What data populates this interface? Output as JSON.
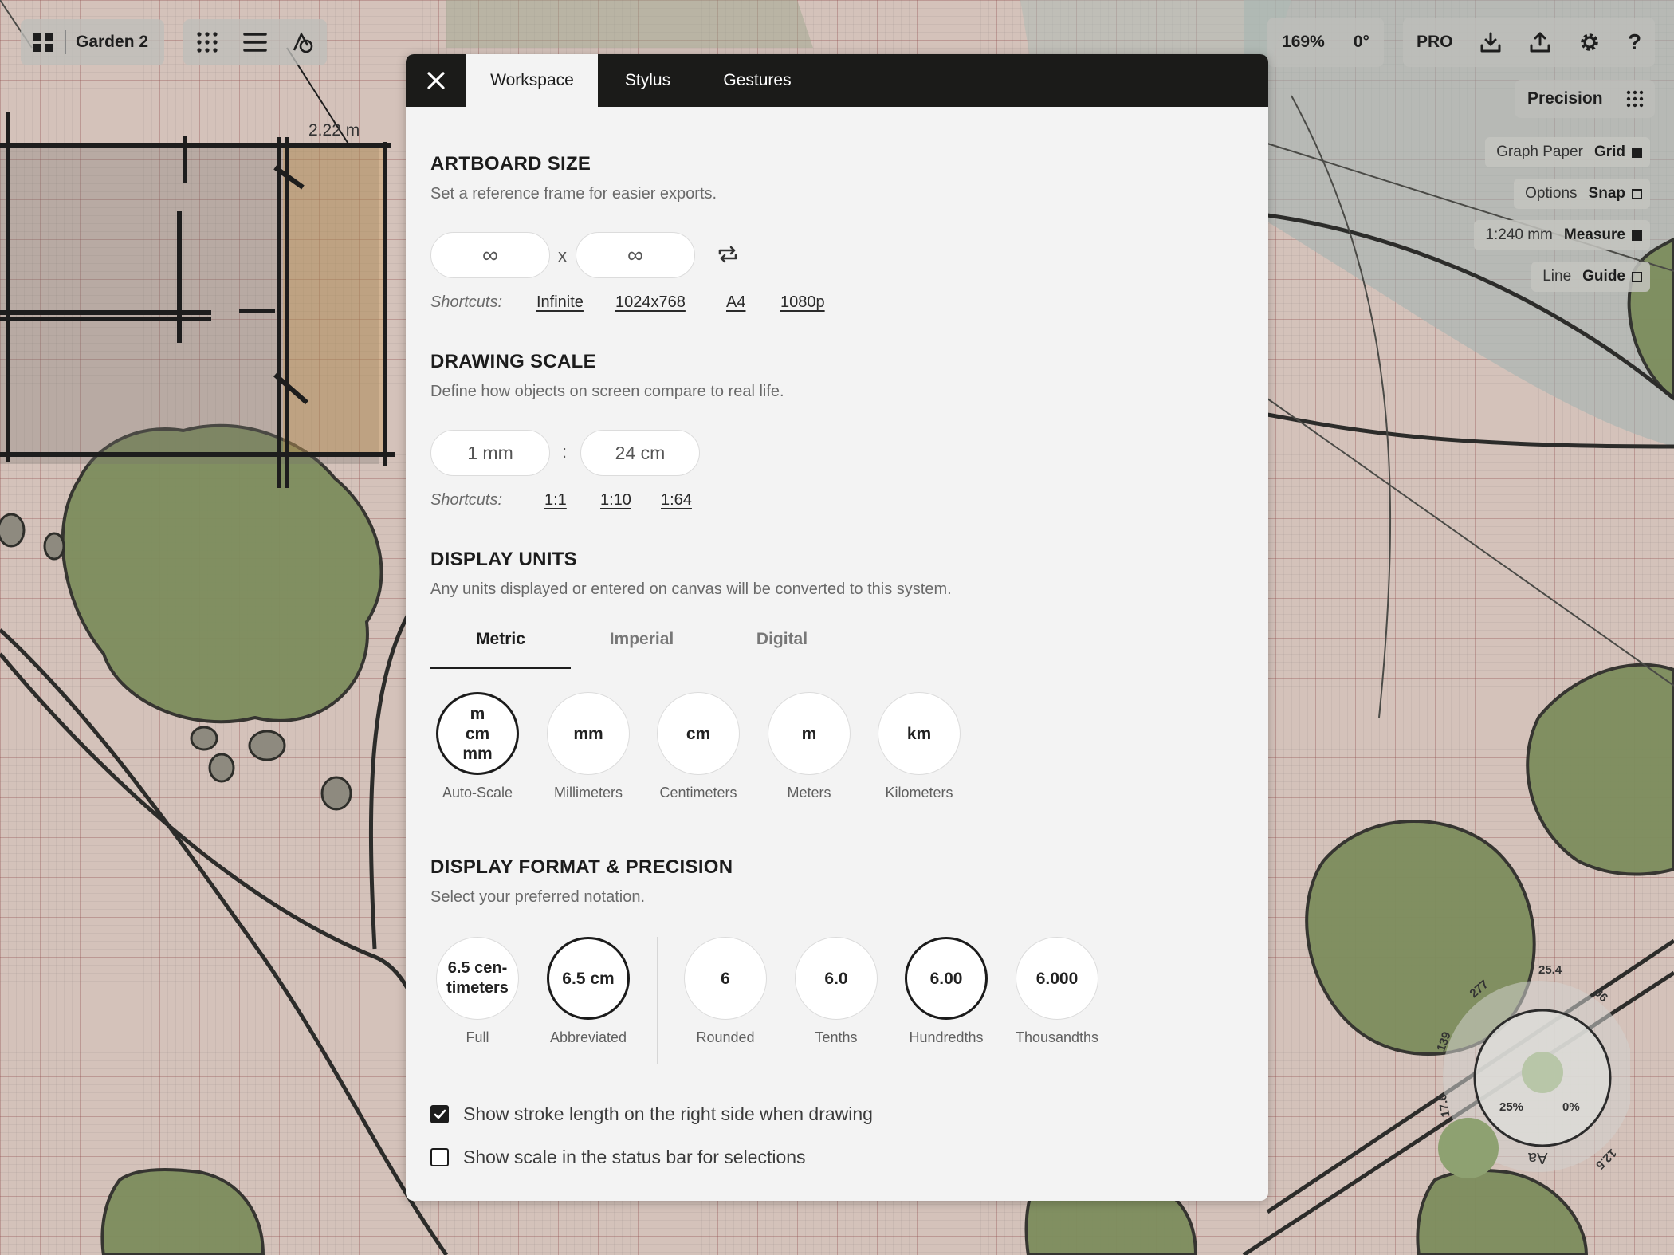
{
  "toolbar": {
    "document_name": "Garden 2",
    "zoom": "169%",
    "rotation": "0°",
    "pro_label": "PRO",
    "precision_label": "Precision",
    "help_label": "?"
  },
  "layers": [
    {
      "label": "Graph Paper",
      "value": "Grid",
      "checked": true
    },
    {
      "label": "Options",
      "value": "Snap",
      "checked": false
    },
    {
      "label": "1:240 mm",
      "value": "Measure",
      "checked": true
    },
    {
      "label": "Line",
      "value": "Guide",
      "checked": false
    }
  ],
  "canvas": {
    "measure_label": "2.22 m",
    "wheel": {
      "top": "25.4",
      "tl": "277",
      "left": "139",
      "bl": "17.6",
      "br": "12.5",
      "tr": "96",
      "opacity": "25%",
      "flow": "0%",
      "text_tool": "Aa"
    }
  },
  "dialog": {
    "close_label": "✕",
    "tabs": [
      "Workspace",
      "Stylus",
      "Gestures"
    ],
    "artboard": {
      "title": "ARTBOARD SIZE",
      "desc": "Set a reference frame for easier exports.",
      "width": "∞",
      "separator": "x",
      "height": "∞",
      "shortcuts_label": "Shortcuts:",
      "shortcuts": [
        "Infinite",
        "1024x768",
        "A4",
        "1080p"
      ]
    },
    "scale": {
      "title": "DRAWING SCALE",
      "desc": "Define how objects on screen compare to real life.",
      "left": "1 mm",
      "separator": ":",
      "right": "24 cm",
      "shortcuts_label": "Shortcuts:",
      "shortcuts": [
        "1:1",
        "1:10",
        "1:64"
      ]
    },
    "units": {
      "title": "DISPLAY UNITS",
      "desc": "Any units displayed or entered on canvas will be converted to this system.",
      "tabs": [
        "Metric",
        "Imperial",
        "Digital"
      ],
      "options": [
        {
          "symbol": "m\ncm\nmm",
          "label": "Auto-Scale",
          "selected": true
        },
        {
          "symbol": "mm",
          "label": "Millimeters",
          "selected": false
        },
        {
          "symbol": "cm",
          "label": "Centimeters",
          "selected": false
        },
        {
          "symbol": "m",
          "label": "Meters",
          "selected": false
        },
        {
          "symbol": "km",
          "label": "Kilometers",
          "selected": false
        }
      ]
    },
    "format": {
      "title": "DISPLAY FORMAT & PRECISION",
      "desc": "Select your preferred notation.",
      "notation": [
        {
          "symbol": "6.5 cen-\ntimeters",
          "label": "Full",
          "selected": false
        },
        {
          "symbol": "6.5 cm",
          "label": "Abbreviated",
          "selected": true
        }
      ],
      "precision": [
        {
          "symbol": "6",
          "label": "Rounded",
          "selected": false
        },
        {
          "symbol": "6.0",
          "label": "Tenths",
          "selected": false
        },
        {
          "symbol": "6.00",
          "label": "Hundredths",
          "selected": true
        },
        {
          "symbol": "6.000",
          "label": "Thousandths",
          "selected": false
        }
      ]
    },
    "options": [
      {
        "label": "Show stroke length on the right side when drawing",
        "checked": true
      },
      {
        "label": "Show scale in the status bar for selections",
        "checked": false
      }
    ]
  }
}
